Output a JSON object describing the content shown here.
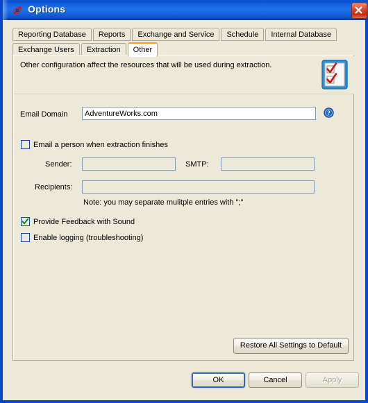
{
  "window": {
    "title": "Options",
    "icon": "pen-icon",
    "close_label": "Close",
    "accent_titlebar": "#1560e0",
    "dialog_bg": "#ece9d8"
  },
  "tabs": {
    "row1": [
      {
        "label": "Reporting Database",
        "selected": false
      },
      {
        "label": "Reports",
        "selected": false
      },
      {
        "label": "Exchange and Service",
        "selected": false
      },
      {
        "label": "Schedule",
        "selected": false
      },
      {
        "label": "Internal Database",
        "selected": false
      }
    ],
    "row2": [
      {
        "label": "Exchange Users",
        "selected": false
      },
      {
        "label": "Extraction",
        "selected": false
      },
      {
        "label": "Other",
        "selected": true
      }
    ],
    "selected_accent": "#f0a030"
  },
  "panel": {
    "description": "Other configuration affect the resources that will be used during extraction.",
    "header_icon": "checklist-icon",
    "email_domain": {
      "label": "Email Domain",
      "value": "AdventureWorks.com",
      "placeholder": "",
      "help_icon": "help-circle-icon"
    },
    "notify": {
      "checkbox_label": "Email a person when extraction finishes",
      "checked": false,
      "sender": {
        "label": "Sender:",
        "value": "",
        "placeholder": ""
      },
      "smtp": {
        "label": "SMTP:",
        "value": "",
        "placeholder": ""
      },
      "recipients": {
        "label": "Recipients:",
        "value": "",
        "placeholder": ""
      },
      "note": "Note: you may separate mulitple entries with \";\""
    },
    "options": [
      {
        "label": "Provide Feedback with Sound",
        "checked": true
      },
      {
        "label": "Enable logging (troubleshooting)",
        "checked": false
      }
    ],
    "restore_button": "Restore All Settings to Default"
  },
  "footer": {
    "ok": "OK",
    "cancel": "Cancel",
    "apply": "Apply",
    "apply_enabled": false
  }
}
